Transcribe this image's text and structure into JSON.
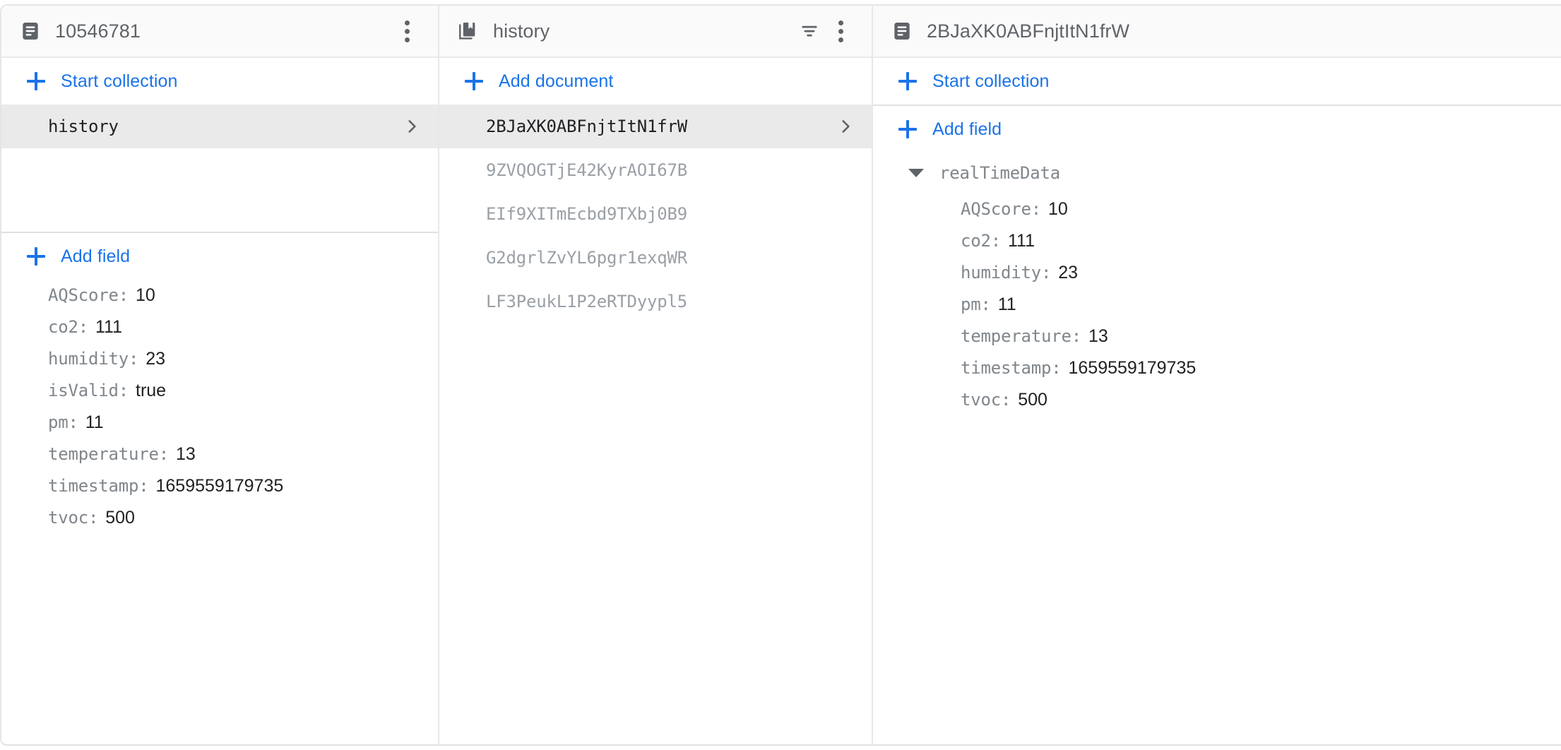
{
  "panels": {
    "document_left": {
      "header": {
        "icon": "document-icon",
        "title": "10546781",
        "menu_icon": "more-vert-icon"
      },
      "start_collection_label": "Start collection",
      "collections": [
        {
          "name": "history",
          "selected": true,
          "chevron": "chevron-right-icon"
        }
      ],
      "add_field_label": "Add field",
      "fields": [
        {
          "key": "AQScore:",
          "value": "10"
        },
        {
          "key": "co2:",
          "value": "111"
        },
        {
          "key": "humidity:",
          "value": "23"
        },
        {
          "key": "isValid:",
          "value": "true"
        },
        {
          "key": "pm:",
          "value": "11"
        },
        {
          "key": "temperature:",
          "value": "13"
        },
        {
          "key": "timestamp:",
          "value": "1659559179735"
        },
        {
          "key": "tvoc:",
          "value": "500"
        }
      ]
    },
    "collection_middle": {
      "header": {
        "icon": "collection-icon",
        "title": "history",
        "filter_icon": "filter-icon",
        "menu_icon": "more-vert-icon"
      },
      "add_document_label": "Add document",
      "documents": [
        {
          "id": "2BJaXK0ABFnjtItN1frW",
          "selected": true,
          "chevron": "chevron-right-icon"
        },
        {
          "id": "9ZVQOGTjE42KyrAOI67B",
          "selected": false
        },
        {
          "id": "EIf9XITmEcbd9TXbj0B9",
          "selected": false
        },
        {
          "id": "G2dgrlZvYL6pgr1exqWR",
          "selected": false
        },
        {
          "id": "LF3PeukL1P2eRTDyypl5",
          "selected": false
        }
      ]
    },
    "document_right": {
      "header": {
        "icon": "document-icon",
        "title": "2BJaXK0ABFnjtItN1frW"
      },
      "start_collection_label": "Start collection",
      "add_field_label": "Add field",
      "map_field": {
        "key": "realTimeData",
        "expanded": true,
        "caret_icon": "caret-down-icon"
      },
      "nested_fields": [
        {
          "key": "AQScore:",
          "value": "10"
        },
        {
          "key": "co2:",
          "value": "111"
        },
        {
          "key": "humidity:",
          "value": "23"
        },
        {
          "key": "pm:",
          "value": "11"
        },
        {
          "key": "temperature:",
          "value": "13"
        },
        {
          "key": "timestamp:",
          "value": "1659559179735"
        },
        {
          "key": "tvoc:",
          "value": "500"
        }
      ]
    }
  },
  "colors": {
    "accent_blue": "#1a73e8",
    "header_bg": "#fafafa",
    "selected_row_bg": "#eaeaea",
    "key_gray": "#80868b",
    "value_dark": "#202124",
    "border_gray": "#e0e0e0"
  }
}
